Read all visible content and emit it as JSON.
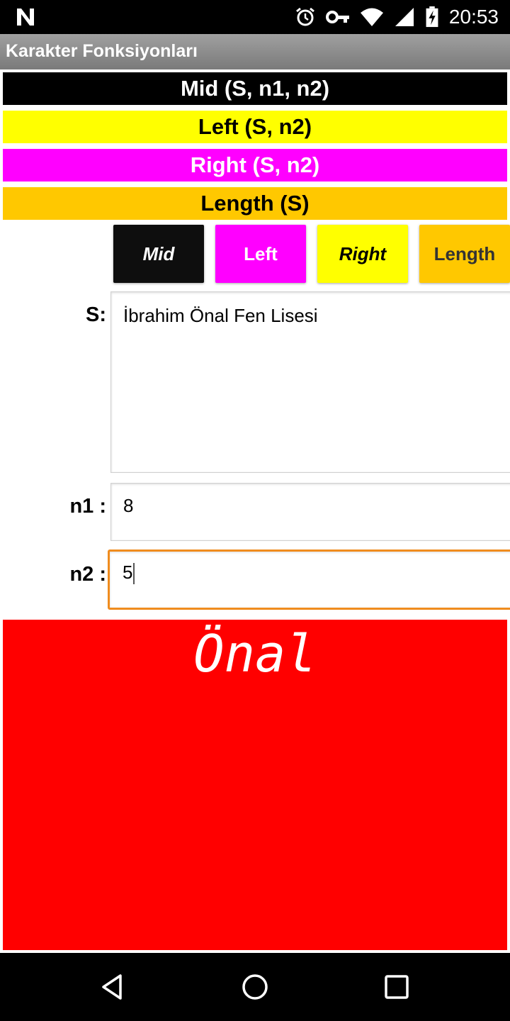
{
  "status_bar": {
    "time": "20:53",
    "icons": [
      "n-logo-icon",
      "alarm-icon",
      "key-icon",
      "wifi-icon",
      "cell-signal-icon",
      "battery-charging-icon"
    ]
  },
  "app_bar": {
    "title": "Karakter Fonksiyonları"
  },
  "strips": [
    {
      "text": "Mid (S, n1, n2)",
      "bg": "#000000",
      "fg": "#ffffff"
    },
    {
      "text": "Left (S, n2)",
      "bg": "#ffff00",
      "fg": "#000000"
    },
    {
      "text": "Right (S, n2)",
      "bg": "#ff00ff",
      "fg": "#ffffff"
    },
    {
      "text": "Length (S)",
      "bg": "#ffc800",
      "fg": "#000000"
    }
  ],
  "buttons": [
    {
      "label": "Mid",
      "bg": "#0e0e0e",
      "fg": "#ffffff"
    },
    {
      "label": "Left",
      "bg": "#ff00ff",
      "fg": "#ffffff"
    },
    {
      "label": "Right",
      "bg": "#ffff00",
      "fg": "#000000"
    },
    {
      "label": "Length",
      "bg": "#ffc800",
      "fg": "#333333"
    }
  ],
  "form": {
    "s_label": "S:",
    "s_value": "İbrahim Önal Fen Lisesi",
    "n1_label": "n1 :",
    "n1_value": "8",
    "n2_label": "n2 :",
    "n2_value": "5"
  },
  "result": {
    "text": "Önal",
    "bg": "#ff0000"
  },
  "nav_bar": {
    "icons": [
      "back-icon",
      "home-icon",
      "recents-icon"
    ]
  }
}
